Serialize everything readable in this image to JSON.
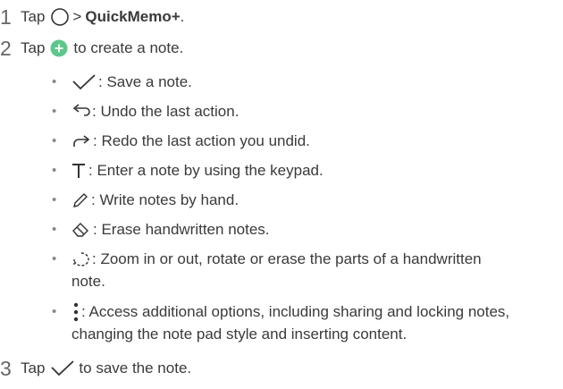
{
  "steps": [
    {
      "num": "1",
      "tap": "Tap",
      "gt": ">",
      "app": "QuickMemo+",
      "end": "."
    },
    {
      "num": "2",
      "tap": "Tap",
      "rest": "to create a note."
    },
    {
      "num": "3",
      "tap": "Tap",
      "rest": "to save the note."
    }
  ],
  "bullets": [
    {
      "icon": "checkmark-icon",
      "text": ": Save a note."
    },
    {
      "icon": "undo-icon",
      "text": ": Undo the last action."
    },
    {
      "icon": "redo-icon",
      "text": ": Redo the last action you undid."
    },
    {
      "icon": "text-t-icon",
      "text": ": Enter a note by using the keypad."
    },
    {
      "icon": "pen-icon",
      "text": ": Write notes by hand."
    },
    {
      "icon": "eraser-icon",
      "text": ": Erase handwritten notes."
    },
    {
      "icon": "lasso-icon",
      "text": ": Zoom in or out, rotate or erase the parts of a handwritten",
      "cont": "note."
    },
    {
      "icon": "more-options-icon",
      "text": ": Access additional options, including sharing and locking notes,",
      "cont": "changing the note pad style and inserting content."
    }
  ],
  "colors": {
    "accent": "#5cc78a",
    "text": "#3a3a3a"
  }
}
